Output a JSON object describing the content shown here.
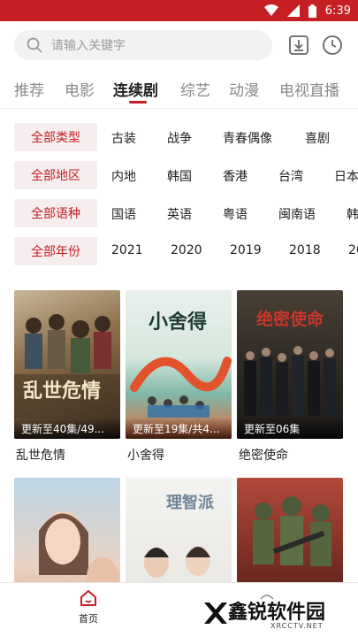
{
  "status_bar": {
    "time": "6:39",
    "icons": [
      "wifi-icon",
      "signal-icon",
      "battery-icon"
    ]
  },
  "search": {
    "placeholder": "请输入关键字"
  },
  "header_icons": [
    "download-icon",
    "history-clock-icon"
  ],
  "tabs": [
    {
      "label": "推荐",
      "active": false
    },
    {
      "label": "电影",
      "active": false
    },
    {
      "label": "连续剧",
      "active": true
    },
    {
      "label": "综艺",
      "active": false
    },
    {
      "label": "动漫",
      "active": false
    },
    {
      "label": "电视直播",
      "active": false
    }
  ],
  "filters": [
    {
      "head": "全部类型",
      "options": [
        "古装",
        "战争",
        "青春偶像",
        "喜剧"
      ]
    },
    {
      "head": "全部地区",
      "options": [
        "内地",
        "韩国",
        "香港",
        "台湾",
        "日本"
      ]
    },
    {
      "head": "全部语种",
      "options": [
        "国语",
        "英语",
        "粤语",
        "闽南语",
        "韩"
      ]
    },
    {
      "head": "全部年份",
      "options": [
        "2021",
        "2020",
        "2019",
        "2018",
        "20"
      ]
    }
  ],
  "shows": [
    {
      "title": "乱世危情",
      "badge": "更新至40集/49...",
      "poster_text": "乱世危情"
    },
    {
      "title": "小舍得",
      "badge": "更新至19集/共4...",
      "poster_text": "小舍得"
    },
    {
      "title": "绝密使命",
      "badge": "更新至06集",
      "poster_text": "绝密使命"
    },
    {
      "title": "",
      "badge": "",
      "poster_text": ""
    },
    {
      "title": "",
      "badge": "",
      "poster_text": "理智派"
    },
    {
      "title": "",
      "badge": "",
      "poster_text": ""
    }
  ],
  "bottom_nav": {
    "home_label": "首页"
  },
  "watermark": {
    "text": "鑫锐软件园",
    "sub": "XRCCTV.NET"
  },
  "colors": {
    "accent": "#c51f24",
    "filter_bg": "#f6eeee"
  }
}
